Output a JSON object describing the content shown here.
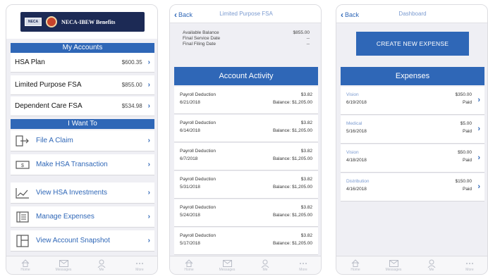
{
  "phone1": {
    "logo_text": "NECA-IBEW Benefits",
    "logo_badge": "NECA",
    "my_accounts_header": "My Accounts",
    "accounts": [
      {
        "name": "HSA Plan",
        "amount": "$600.35"
      },
      {
        "name": "Limited Purpose FSA",
        "amount": "$855.00"
      },
      {
        "name": "Dependent Care FSA",
        "amount": "$534.98"
      }
    ],
    "i_want_to_header": "I Want To",
    "actions": [
      {
        "label": "File A Claim",
        "icon": "file-claim-icon"
      },
      {
        "label": "Make HSA Transaction",
        "icon": "dollar-bill-icon"
      },
      {
        "label": "View HSA Investments",
        "icon": "line-chart-icon"
      },
      {
        "label": "Manage Expenses",
        "icon": "receipt-list-icon"
      },
      {
        "label": "View Account Snapshot",
        "icon": "snapshot-grid-icon"
      }
    ]
  },
  "phone2": {
    "back_label": "Back",
    "title": "Limited Purpose FSA",
    "balance_rows": [
      {
        "label": "Available Balance",
        "value": "$855.00"
      },
      {
        "label": "Final Service Date",
        "value": "--"
      },
      {
        "label": "Final Filing Date",
        "value": "--"
      }
    ],
    "activity_header": "Account Activity",
    "activities": [
      {
        "desc": "Payroll Deduction",
        "amount": "$3.82",
        "date": "6/21/2018",
        "balance": "Balance: $1,205.00"
      },
      {
        "desc": "Payroll Deduction",
        "amount": "$3.82",
        "date": "6/14/2018",
        "balance": "Balance: $1,205.00"
      },
      {
        "desc": "Payroll Deduction",
        "amount": "$3.82",
        "date": "6/7/2018",
        "balance": "Balance: $1,205.00"
      },
      {
        "desc": "Payroll Deduction",
        "amount": "$3.82",
        "date": "5/31/2018",
        "balance": "Balance: $1,205.00"
      },
      {
        "desc": "Payroll Deduction",
        "amount": "$3.82",
        "date": "5/24/2018",
        "balance": "Balance: $1,205.00"
      },
      {
        "desc": "Payroll Deduction",
        "amount": "$3.82",
        "date": "5/17/2018",
        "balance": "Balance: $1,205.00"
      }
    ]
  },
  "phone3": {
    "back_label": "Back",
    "title": "Dashboard",
    "create_button": "CREATE NEW EXPENSE",
    "expenses_header": "Expenses",
    "expenses": [
      {
        "type": "Vision",
        "amount": "$350.00",
        "date": "6/19/2018",
        "status": "Paid"
      },
      {
        "type": "Medical",
        "amount": "$5.00",
        "date": "5/16/2018",
        "status": "Paid"
      },
      {
        "type": "Vision",
        "amount": "$50.00",
        "date": "4/18/2018",
        "status": "Paid"
      },
      {
        "type": "Distribution",
        "amount": "$150.00",
        "date": "4/16/2018",
        "status": "Paid"
      }
    ]
  },
  "tabbar": {
    "tabs": [
      {
        "label": "Home",
        "icon": "home-icon"
      },
      {
        "label": "Messages",
        "icon": "mail-icon"
      },
      {
        "label": "Me",
        "icon": "person-icon"
      },
      {
        "label": "More",
        "icon": "more-dots-icon"
      }
    ]
  },
  "colors": {
    "accent": "#2f67b7",
    "background": "#efeff4",
    "logo_banner": "#1c2a55"
  }
}
